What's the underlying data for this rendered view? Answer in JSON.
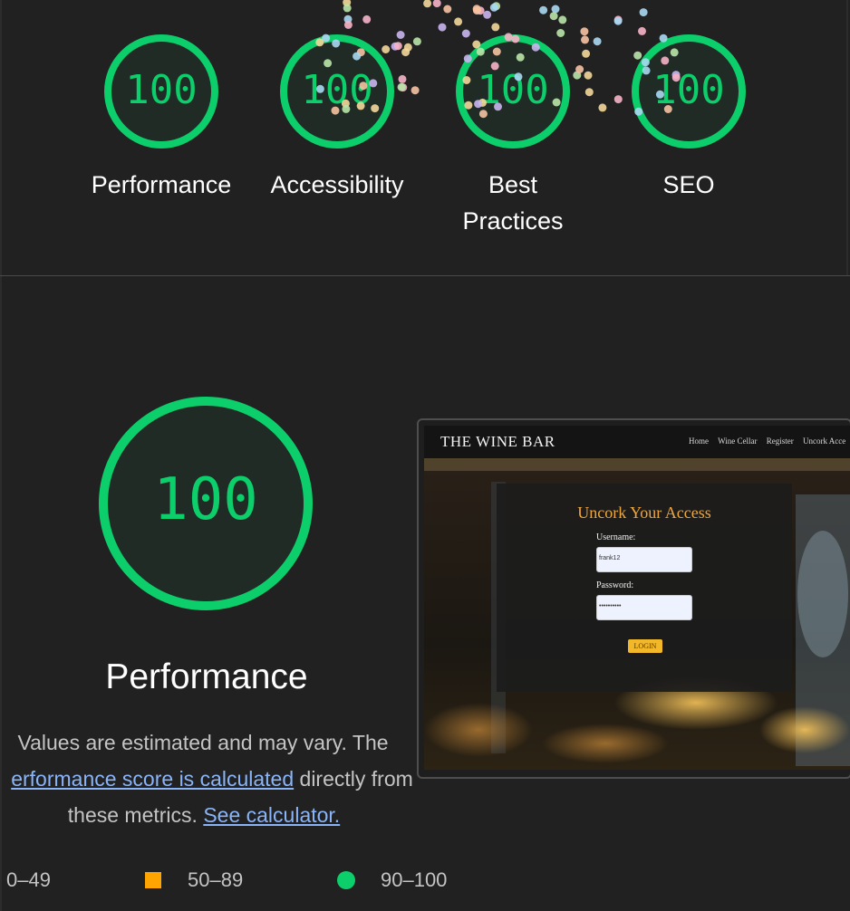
{
  "summary_gauges": [
    {
      "score": "100",
      "label_lines": [
        "Performance"
      ]
    },
    {
      "score": "100",
      "label_lines": [
        "Accessibility"
      ]
    },
    {
      "score": "100",
      "label_lines": [
        "Best",
        "Practices"
      ]
    },
    {
      "score": "100",
      "label_lines": [
        "SEO"
      ]
    }
  ],
  "performance": {
    "score": "100",
    "title": "Performance",
    "description": {
      "line1_text": "Values are estimated and may vary. The",
      "link1": "erformance score is calculated",
      "line2_after": " directly from",
      "line3_text": "these metrics. ",
      "link2": "See calculator."
    }
  },
  "screenshot": {
    "brand": "THE WINE BAR",
    "nav_links": [
      "Home",
      "Wine Cellar",
      "Register",
      "Uncork Acce"
    ],
    "login_title": "Uncork Your Access",
    "username_label": "Username:",
    "username_value": "frank12",
    "password_label": "Password:",
    "password_value": "••••••••••",
    "login_button": "LOGIN"
  },
  "legend": [
    {
      "range": "0–49",
      "icon": "triangle-fail-icon"
    },
    {
      "range": "50–89",
      "icon": "square-average-icon",
      "color": "#ffa400"
    },
    {
      "range": "90–100",
      "icon": "circle-pass-icon",
      "color": "#0cce6b"
    }
  ],
  "colors": {
    "pass": "#0cce6b",
    "average": "#ffa400",
    "link": "#8ab4f8",
    "background": "#212121"
  }
}
